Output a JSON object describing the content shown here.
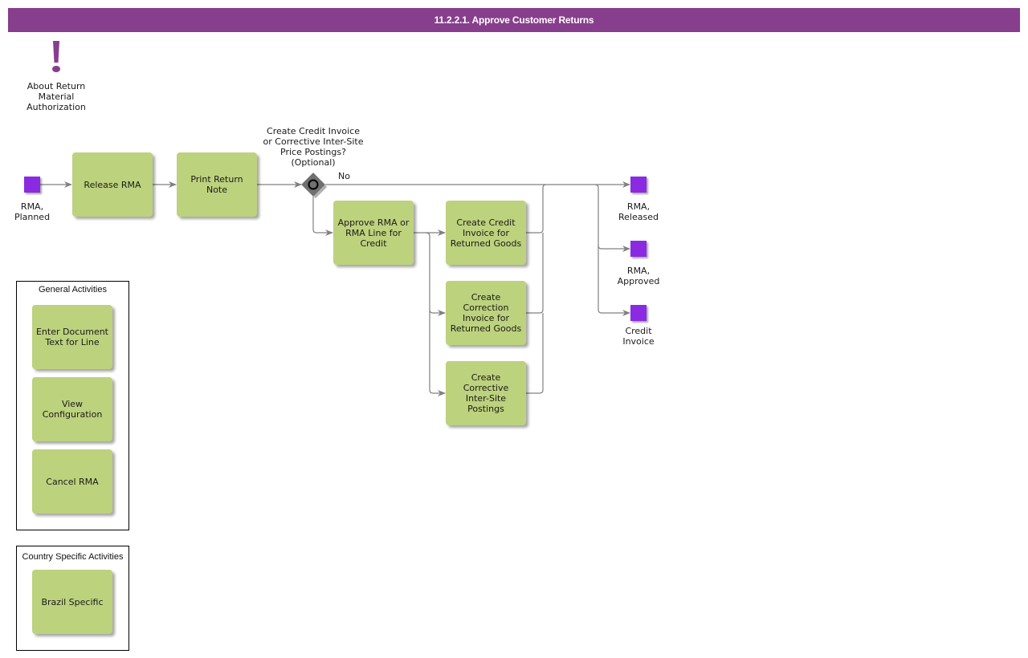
{
  "header": {
    "title": "11.2.2.1. Approve Customer Returns"
  },
  "info": {
    "icon": "exclamation-icon",
    "label": "About Return\nMaterial\nAuthorization"
  },
  "colors": {
    "header": "#873e8c",
    "task": "#bdd27d",
    "event": "#8a2be2",
    "connector": "#808080",
    "gateway": "#6b6b6b"
  },
  "events": {
    "start": "RMA,\nPlanned",
    "released": "RMA,\nReleased",
    "approved": "RMA,\nApproved",
    "credit_invoice": "Credit\nInvoice"
  },
  "tasks": {
    "release_rma": "Release RMA",
    "print_return_note": "Print Return\nNote",
    "approve_rma": "Approve RMA or\nRMA Line for\nCredit",
    "create_credit_invoice": "Create Credit\nInvoice for\nReturned Goods",
    "create_correction_invoice": "Create\nCorrection\nInvoice for\nReturned Goods",
    "create_corrective_postings": "Create\nCorrective\nInter-Site\nPostings"
  },
  "gateway": {
    "question": "Create Credit Invoice\nor Corrective Inter-Site\nPrice Postings?\n(Optional)",
    "no_label": "No"
  },
  "general_activities": {
    "title": "General Activities",
    "items": [
      "Enter Document\nText for Line",
      "View\nConfiguration",
      "Cancel RMA"
    ]
  },
  "country_activities": {
    "title": "Country Specific Activities",
    "items": [
      "Brazil Specific"
    ]
  }
}
